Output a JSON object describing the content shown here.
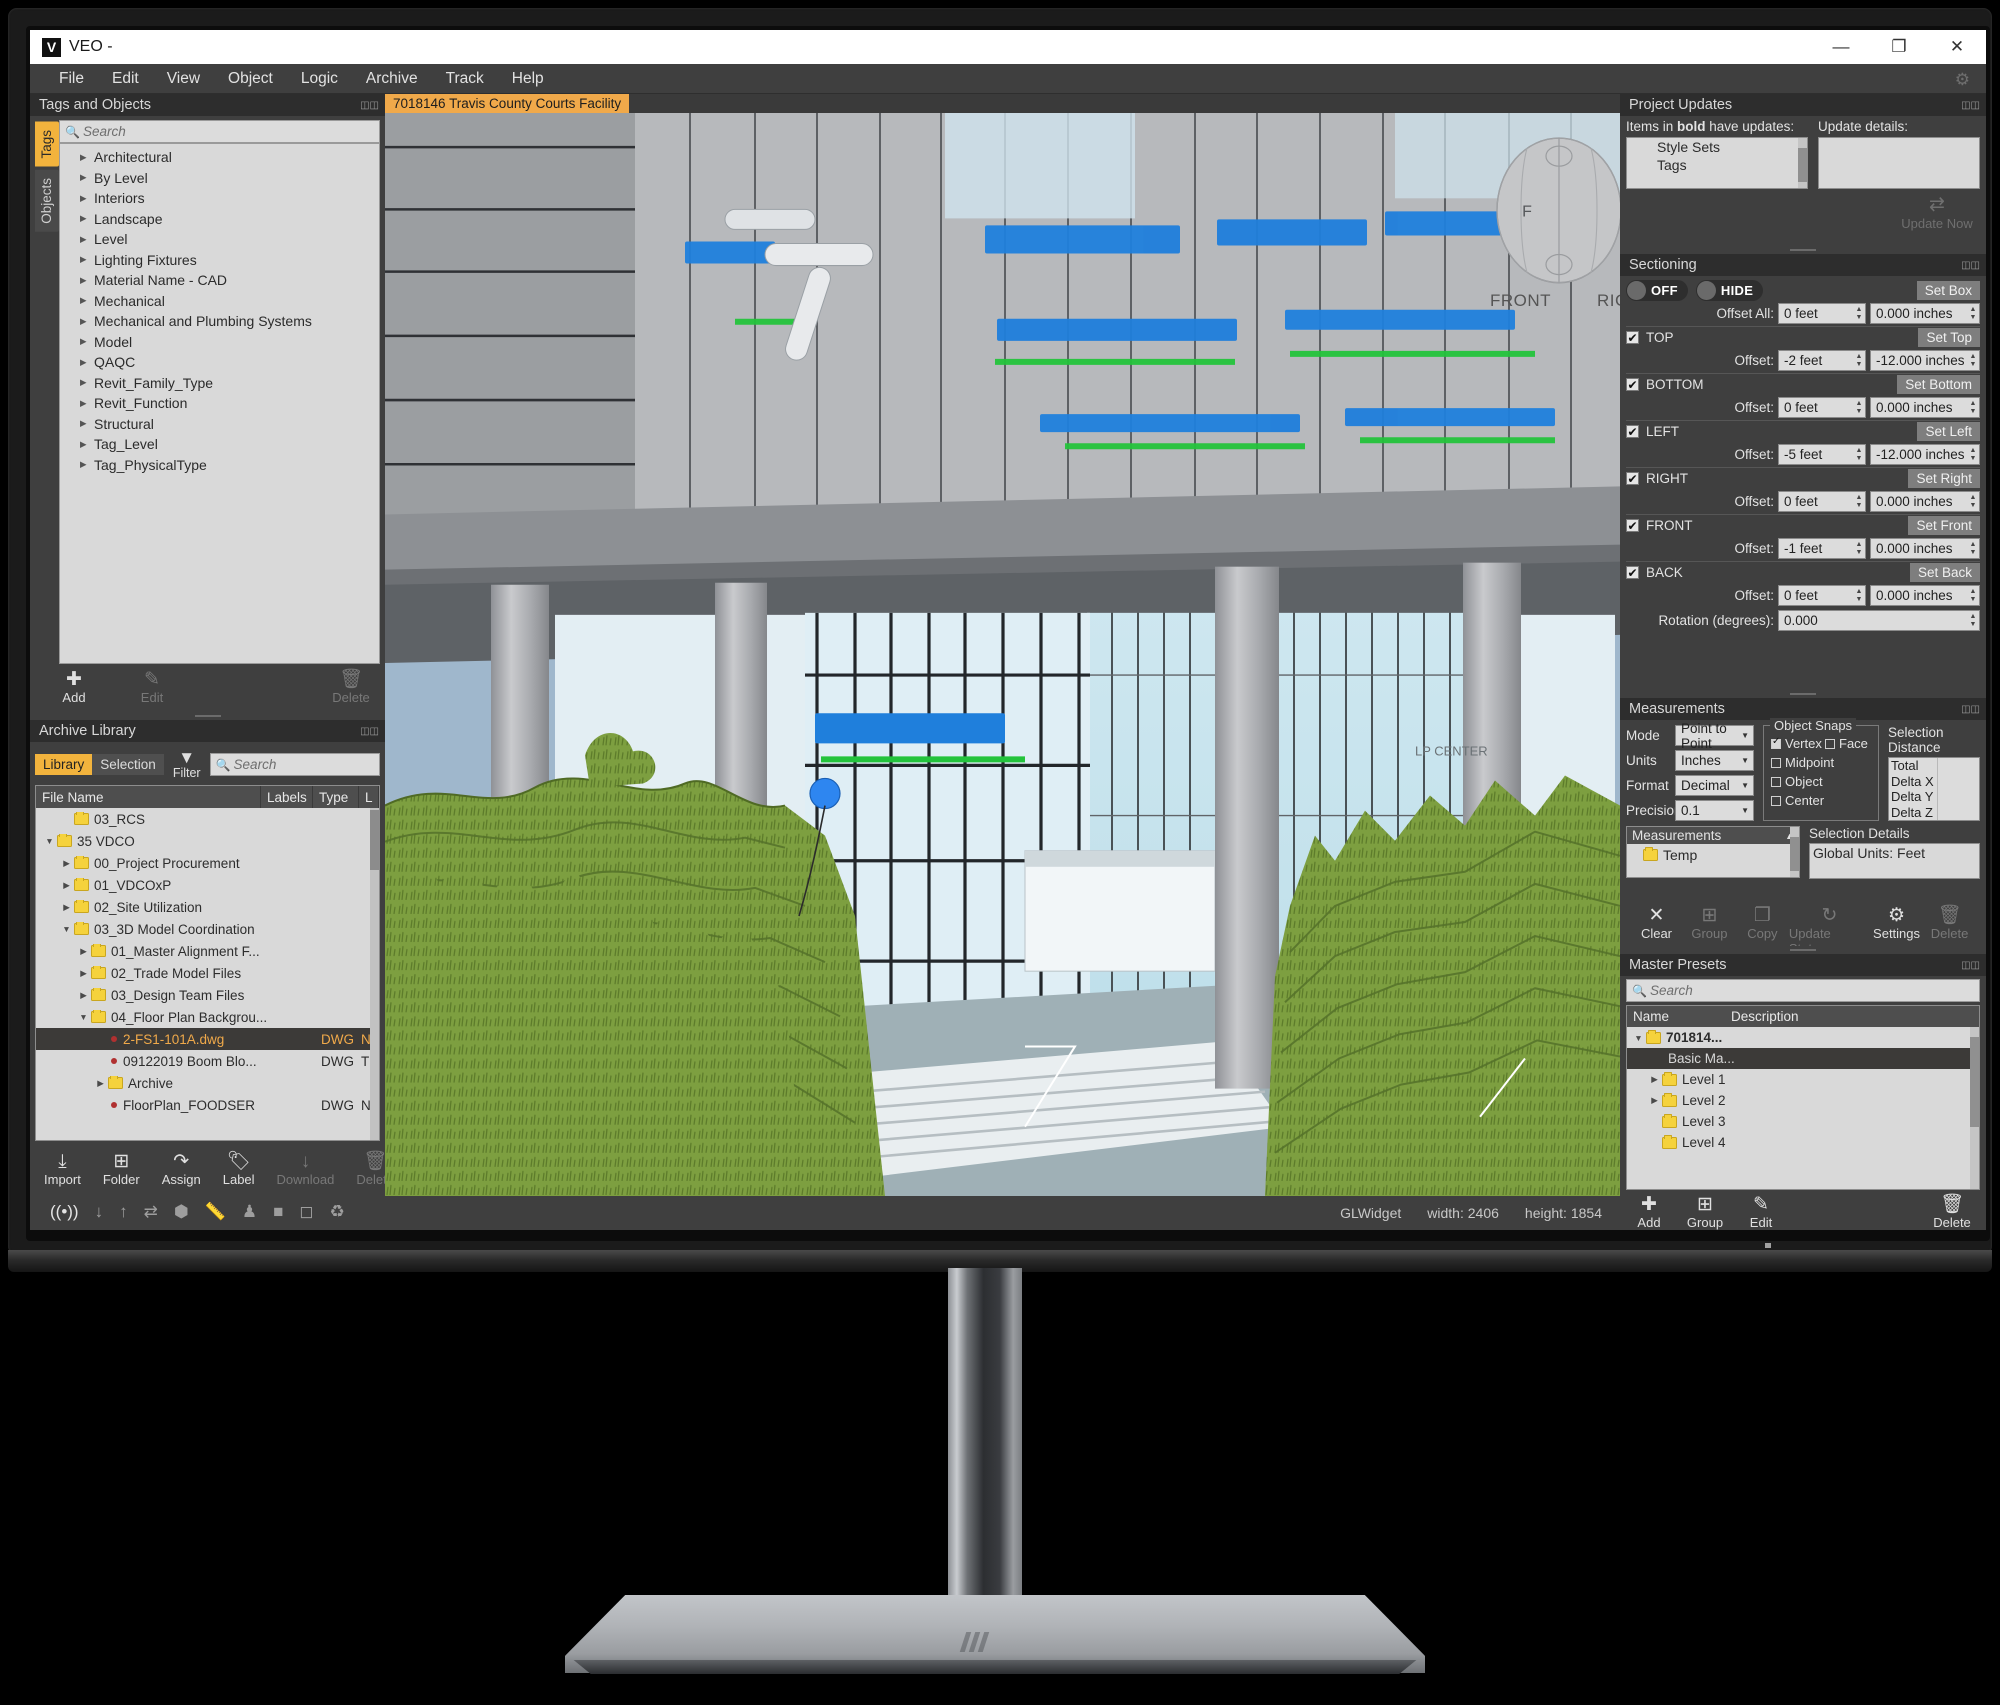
{
  "window": {
    "title": "VEO -",
    "logo_letter": "V",
    "minimize": "—",
    "maximize": "❐",
    "close": "✕",
    "gear_icon": "gear-icon"
  },
  "menubar": [
    "File",
    "Edit",
    "View",
    "Object",
    "Logic",
    "Archive",
    "Track",
    "Help"
  ],
  "tags_panel": {
    "title": "Tags and Objects",
    "tabs": [
      {
        "label": "Tags",
        "active": true
      },
      {
        "label": "Objects",
        "active": false
      }
    ],
    "search_placeholder": "Search",
    "items": [
      "Architectural",
      "By Level",
      "Interiors",
      "Landscape",
      "Level",
      "Lighting Fixtures",
      "Material Name - CAD",
      "Mechanical",
      "Mechanical and Plumbing Systems",
      "Model",
      "QAQC",
      "Revit_Family_Type",
      "Revit_Function",
      "Structural",
      "Tag_Level",
      "Tag_PhysicalType"
    ],
    "buttons": [
      {
        "label": "Add",
        "icon": "plus-icon",
        "enabled": true
      },
      {
        "label": "Edit",
        "icon": "pencil-icon",
        "enabled": false
      },
      {
        "label": "Delete",
        "icon": "trash-icon",
        "enabled": false
      }
    ]
  },
  "archive_panel": {
    "title": "Archive Library",
    "segmented": [
      {
        "label": "Library",
        "active": true
      },
      {
        "label": "Selection",
        "active": false
      }
    ],
    "filter_label": "Filter",
    "filter_icon": "funnel-icon",
    "search_placeholder": "Search",
    "columns": [
      "File Name",
      "Labels",
      "Type",
      "L"
    ],
    "rows": [
      {
        "name": "03_RCS",
        "indent": 1,
        "arrow": "",
        "kind": "folder",
        "type": "",
        "label": ""
      },
      {
        "name": "35 VDCO",
        "indent": 0,
        "arrow": "down",
        "kind": "folder",
        "type": "",
        "label": ""
      },
      {
        "name": "00_Project Procurement",
        "indent": 1,
        "arrow": "right",
        "kind": "folder",
        "type": "",
        "label": ""
      },
      {
        "name": "01_VDCOxP",
        "indent": 1,
        "arrow": "right",
        "kind": "folder",
        "type": "",
        "label": ""
      },
      {
        "name": "02_Site Utilization",
        "indent": 1,
        "arrow": "right",
        "kind": "folder",
        "type": "",
        "label": ""
      },
      {
        "name": "03_3D Model Coordination",
        "indent": 1,
        "arrow": "down",
        "kind": "folder",
        "type": "",
        "label": ""
      },
      {
        "name": "01_Master Alignment F...",
        "indent": 2,
        "arrow": "right",
        "kind": "folder",
        "type": "",
        "label": ""
      },
      {
        "name": "02_Trade Model Files",
        "indent": 2,
        "arrow": "right",
        "kind": "folder",
        "type": "",
        "label": ""
      },
      {
        "name": "03_Design Team Files",
        "indent": 2,
        "arrow": "right",
        "kind": "folder",
        "type": "",
        "label": ""
      },
      {
        "name": "04_Floor Plan Backgrou...",
        "indent": 2,
        "arrow": "down",
        "kind": "folder",
        "type": "",
        "label": ""
      },
      {
        "name": "2-FS1-101A.dwg",
        "indent": 3,
        "arrow": "",
        "kind": "file",
        "type": "DWG",
        "label": "N",
        "selected": true
      },
      {
        "name": "09122019 Boom Blo...",
        "indent": 3,
        "arrow": "",
        "kind": "file",
        "type": "DWG",
        "label": "T"
      },
      {
        "name": "Archive",
        "indent": 3,
        "arrow": "right",
        "kind": "folder",
        "type": "",
        "label": ""
      },
      {
        "name": "FloorPlan_FOODSER",
        "indent": 3,
        "arrow": "",
        "kind": "file",
        "type": "DWG",
        "label": "N"
      }
    ],
    "buttons": [
      {
        "label": "Import",
        "icon": "download-into-icon"
      },
      {
        "label": "Folder",
        "icon": "new-folder-icon"
      },
      {
        "label": "Assign",
        "icon": "assign-arrow-icon"
      },
      {
        "label": "Label",
        "icon": "tag-icon"
      },
      {
        "label": "Download",
        "icon": "down-arrow-icon"
      },
      {
        "label": "Delete",
        "icon": "trash-icon"
      }
    ],
    "status_icons": [
      "broadcast-icon",
      "download-icon",
      "upload-icon",
      "sync-icon",
      "cube-icon",
      "ruler-icon",
      "person-icon",
      "box-icon",
      "camera-icon",
      "refresh-folder-icon"
    ]
  },
  "viewport": {
    "tab_label": "7018146 Travis County Courts Facility",
    "navcube_front": "FRONT",
    "navcube_right": "RIGHT",
    "status_widget": "GLWidget",
    "status_width_label": "width:",
    "status_width": "2406",
    "status_height_label": "height:",
    "status_height": "1854"
  },
  "project_updates": {
    "title": "Project Updates",
    "bold_note_pre": "Items in ",
    "bold_note_bold": "bold",
    "bold_note_post": " have updates:",
    "details_label": "Update details:",
    "items": [
      "Style Sets",
      "Tags"
    ],
    "update_now": "Update Now",
    "update_now_icon": "sync-icon",
    "details_value": ""
  },
  "sectioning": {
    "title": "Sectioning",
    "toggle_off": "OFF",
    "toggle_hide": "HIDE",
    "set_box": "Set Box",
    "offset_all_label": "Offset All:",
    "offset_all_feet": "0 feet",
    "offset_all_inches": "0.000 inches",
    "offset_label": "Offset:",
    "planes": [
      {
        "name": "TOP",
        "checked": true,
        "set_label": "Set Top",
        "feet": "-2 feet",
        "inches": "-12.000 inches"
      },
      {
        "name": "BOTTOM",
        "checked": true,
        "set_label": "Set Bottom",
        "feet": "0 feet",
        "inches": "0.000 inches"
      },
      {
        "name": "LEFT",
        "checked": true,
        "set_label": "Set Left",
        "feet": "-5 feet",
        "inches": "-12.000 inches"
      },
      {
        "name": "RIGHT",
        "checked": true,
        "set_label": "Set Right",
        "feet": "0 feet",
        "inches": "0.000 inches"
      },
      {
        "name": "FRONT",
        "checked": true,
        "set_label": "Set Front",
        "feet": "-1 feet",
        "inches": "0.000 inches"
      },
      {
        "name": "BACK",
        "checked": true,
        "set_label": "Set Back",
        "feet": "0 feet",
        "inches": "0.000 inches"
      }
    ],
    "rotation_label": "Rotation (degrees):",
    "rotation_value": "0.000"
  },
  "measurements": {
    "title": "Measurements",
    "mode_label": "Mode",
    "mode_value": "Point to Point",
    "units_label": "Units",
    "units_value": "Inches",
    "format_label": "Format",
    "format_value": "Decimal",
    "precision_label": "Precision",
    "precision_value": "0.1",
    "snaps_caption": "Object Snaps",
    "snaps": [
      {
        "label": "Vertex",
        "checked": true
      },
      {
        "label": "Face",
        "checked": false
      },
      {
        "label": "Midpoint",
        "checked": false
      },
      {
        "label": "Object",
        "checked": false
      },
      {
        "label": "Center",
        "checked": false
      }
    ],
    "selection_distance_caption": "Selection Distance",
    "distance_rows": [
      {
        "key": "Total",
        "value": ""
      },
      {
        "key": "Delta X",
        "value": ""
      },
      {
        "key": "Delta Y",
        "value": ""
      },
      {
        "key": "Delta Z",
        "value": ""
      }
    ],
    "list_caption": "Measurements",
    "list_items": [
      "Temp"
    ],
    "selection_details_caption": "Selection Details",
    "selection_details_value": "Global Units: Feet",
    "buttons": [
      {
        "label": "Clear",
        "icon": "x-icon",
        "enabled": true
      },
      {
        "label": "Group",
        "icon": "new-folder-icon",
        "enabled": false
      },
      {
        "label": "Copy",
        "icon": "copy-icon",
        "enabled": false
      },
      {
        "label": "Update Status",
        "icon": "refresh-icon",
        "enabled": false
      },
      {
        "label": "Settings",
        "icon": "gear-icon",
        "enabled": true
      },
      {
        "label": "Delete",
        "icon": "trash-icon",
        "enabled": false
      }
    ]
  },
  "master_presets": {
    "title": "Master Presets",
    "search_placeholder": "Search",
    "columns": [
      "Name",
      "Description"
    ],
    "rows": [
      {
        "name": "701814...",
        "indent": 0,
        "arrow": "down",
        "kind": "folder",
        "bold": true,
        "selected": false
      },
      {
        "name": "Basic Ma...",
        "indent": 1,
        "arrow": "",
        "kind": "item",
        "bold": false,
        "selected": true
      },
      {
        "name": "Level 1",
        "indent": 1,
        "arrow": "right",
        "kind": "folder",
        "bold": false,
        "selected": false
      },
      {
        "name": "Level 2",
        "indent": 1,
        "arrow": "right",
        "kind": "folder",
        "bold": false,
        "selected": false
      },
      {
        "name": "Level 3",
        "indent": 1,
        "arrow": "",
        "kind": "folder",
        "bold": false,
        "selected": false
      },
      {
        "name": "Level 4",
        "indent": 1,
        "arrow": "",
        "kind": "folder",
        "bold": false,
        "selected": false
      }
    ],
    "buttons": [
      {
        "label": "Add",
        "icon": "plus-icon"
      },
      {
        "label": "Group",
        "icon": "new-folder-icon"
      },
      {
        "label": "Edit",
        "icon": "pencil-icon"
      },
      {
        "label": "Delete",
        "icon": "trash-icon"
      }
    ]
  },
  "colors": {
    "accent": "#f2b33d",
    "tab_accent": "#f0a94a",
    "panel_bg": "#3f3f3f",
    "panel_title_bg": "#2d2d2d",
    "list_bg": "#d9d9d9",
    "sky": "#9fb7cc",
    "terrain_green": "#7a9b3c",
    "duct_blue": "#1a74d6",
    "pipe_green": "#24c03a"
  }
}
